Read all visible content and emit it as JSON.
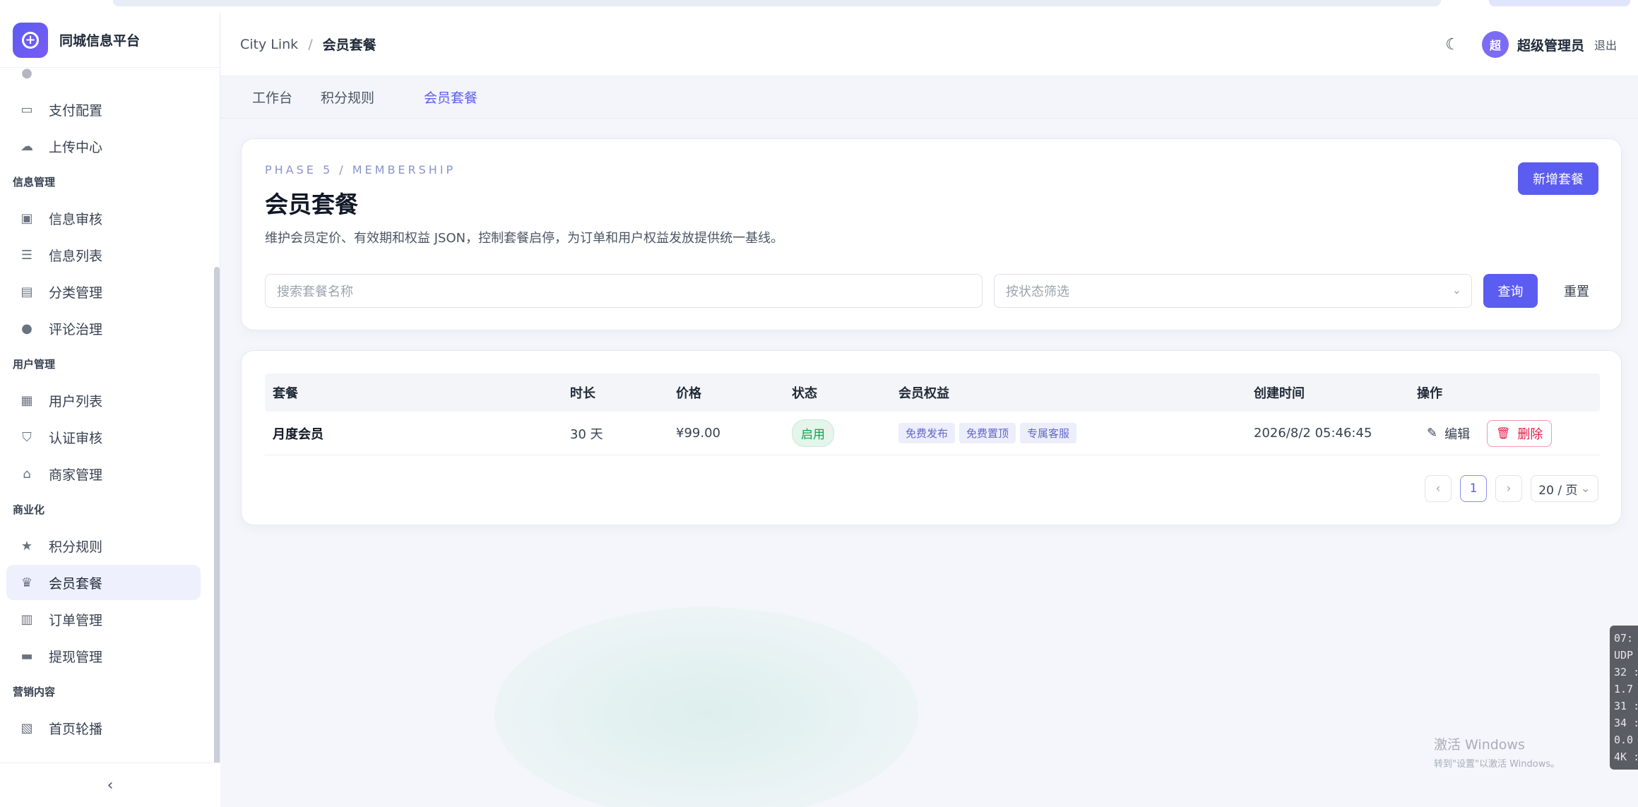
{
  "brand": {
    "title": "同城信息平台"
  },
  "sidebar": {
    "items_top": [
      {
        "label": "支付配置",
        "icon": "card-icon"
      },
      {
        "label": "上传中心",
        "icon": "upload-icon"
      }
    ],
    "groups": [
      {
        "title": "信息管理",
        "items": [
          {
            "label": "信息审核",
            "icon": "clipboard-icon"
          },
          {
            "label": "信息列表",
            "icon": "list-check-icon"
          },
          {
            "label": "分类管理",
            "icon": "folder-icon"
          },
          {
            "label": "评论治理",
            "icon": "chat-icon"
          }
        ]
      },
      {
        "title": "用户管理",
        "items": [
          {
            "label": "用户列表",
            "icon": "id-card-icon"
          },
          {
            "label": "认证审核",
            "icon": "shield-icon"
          },
          {
            "label": "商家管理",
            "icon": "store-icon"
          }
        ]
      },
      {
        "title": "商业化",
        "items": [
          {
            "label": "积分规则",
            "icon": "star-icon"
          },
          {
            "label": "会员套餐",
            "icon": "crown-icon",
            "active": true
          },
          {
            "label": "订单管理",
            "icon": "document-icon"
          },
          {
            "label": "提现管理",
            "icon": "wallet-icon"
          }
        ]
      },
      {
        "title": "营销内容",
        "items": [
          {
            "label": "首页轮播",
            "icon": "image-icon"
          }
        ]
      }
    ]
  },
  "header": {
    "breadcrumb_root": "City Link",
    "breadcrumb_sep": "/",
    "breadcrumb_current": "会员套餐",
    "avatar_char": "超",
    "username": "超级管理员",
    "logout": "退出"
  },
  "tabs": [
    "工作台",
    "积分规则",
    "会员套餐"
  ],
  "page": {
    "eyebrow": "PHASE 5 / MEMBERSHIP",
    "title": "会员套餐",
    "description": "维护会员定价、有效期和权益 JSON，控制套餐启停，为订单和用户权益发放提供统一基线。",
    "new_button": "新增套餐",
    "search_placeholder": "搜索套餐名称",
    "status_placeholder": "按状态筛选",
    "query_button": "查询",
    "reset_button": "重置"
  },
  "table": {
    "headers": [
      "套餐",
      "时长",
      "价格",
      "状态",
      "会员权益",
      "创建时间",
      "操作"
    ],
    "rows": [
      {
        "name": "月度会员",
        "duration": "30 天",
        "price": "¥99.00",
        "status": "启用",
        "benefits": [
          "免费发布",
          "免费置顶",
          "专属客服"
        ],
        "created": "2026/8/2 05:46:45",
        "edit": "编辑",
        "delete": "删除"
      }
    ]
  },
  "pager": {
    "current": "1",
    "page_size": "20 / 页"
  },
  "watermark": {
    "line1": "激活 Windows",
    "line2": "转到\"设置\"以激活 Windows。"
  },
  "overlay": {
    "lines": [
      "07:",
      "UDP",
      "32 :",
      "1.7",
      "31 :",
      "34 :",
      "0.0",
      "4K :"
    ]
  },
  "colors": {
    "accent": "#5b5cf0",
    "success": "#16a34a",
    "danger": "#e11d48"
  }
}
